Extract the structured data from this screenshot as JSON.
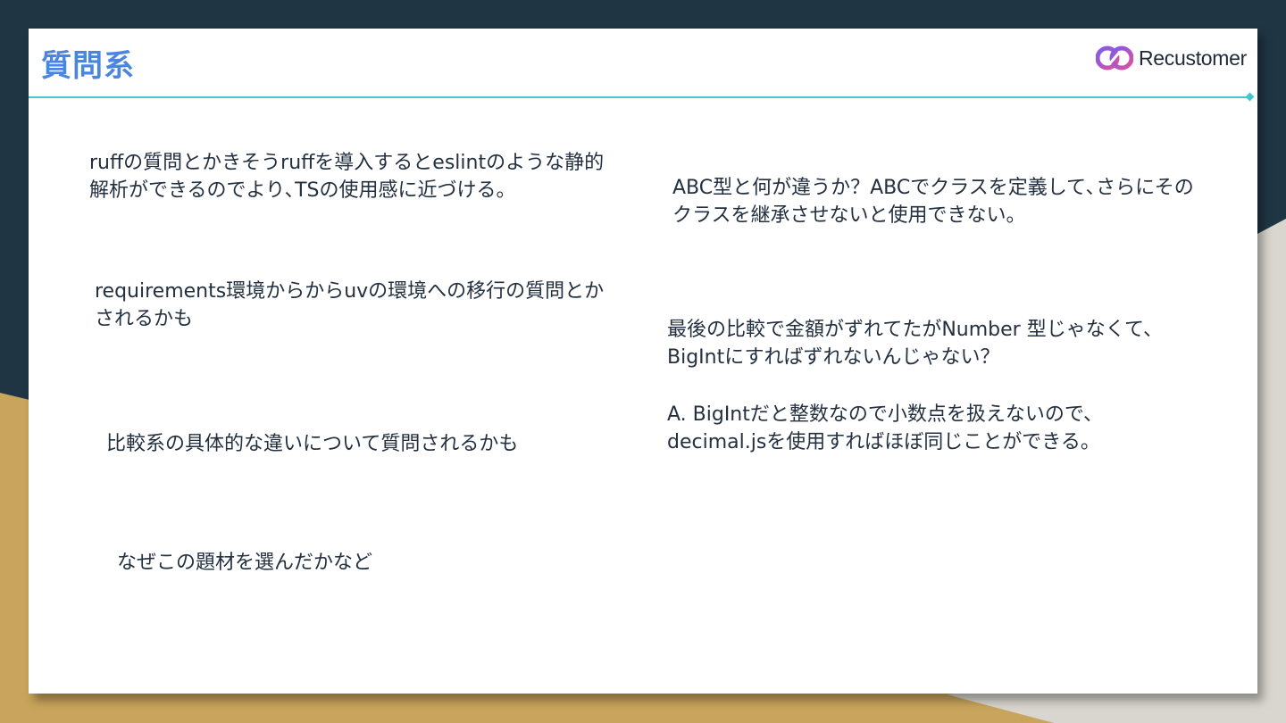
{
  "slide": {
    "title": "質問系",
    "brand": "Recustomer"
  },
  "notes_left": [
    {
      "lines": [
        "ruffの質問とかきそうruffを導入するとeslintのような静的",
        "解析ができるのでより､TSの使用感に近づける。"
      ]
    },
    {
      "lines": [
        "requirements環境からからuvの環境への移行の質問とか",
        "されるかも"
      ]
    },
    {
      "lines": [
        "比較系の具体的な違いについて質問されるかも"
      ]
    },
    {
      "lines": [
        "なぜこの題材を選んだかなど"
      ]
    }
  ],
  "notes_right": [
    {
      "lines": [
        "ABC型と何が違うか？ABCでクラスを定義して､さらにその",
        "クラスを継承させないと使用できない。"
      ]
    },
    {
      "lines": [
        "最後の比較で金額がずれてたがNumber 型じゃなくて、",
        "BigIntにすればずれないんじゃない？"
      ]
    },
    {
      "lines": [
        "A. BigIntだと整数なので小数点を扱えないので、",
        "decimal.jsを使用すればほぼ同じことができる。"
      ]
    }
  ],
  "colors": {
    "background_dark": "#203544",
    "background_gold": "#c9a45c",
    "title": "#4a86e0",
    "rule": "#46c7cf",
    "body_text": "#233040"
  },
  "icons": [
    "recustomer-logo-icon"
  ]
}
